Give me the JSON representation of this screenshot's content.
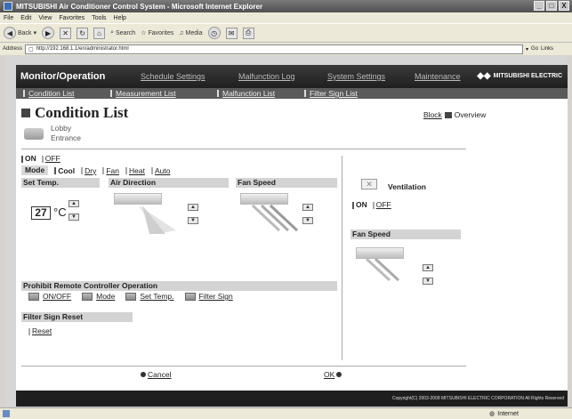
{
  "window": {
    "title": "MITSUBISHI Air Conditioner Control System - Microsoft Internet Explorer",
    "controls": [
      "_",
      "□",
      "X"
    ]
  },
  "menubar": [
    "File",
    "Edit",
    "View",
    "Favorites",
    "Tools",
    "Help"
  ],
  "toolbar": {
    "back": "Back",
    "search": "Search",
    "favorites": "Favorites",
    "media": "Media"
  },
  "address": {
    "label": "Address",
    "url": "http://192.168.1.1/en/administrator.html",
    "go": "Go",
    "links": "Links"
  },
  "nav": {
    "title": "Monitor/Operation",
    "items": [
      "Schedule Settings",
      "Malfunction Log",
      "System Settings",
      "Maintenance"
    ],
    "brand": "MITSUBISHI ELECTRIC"
  },
  "subnav": {
    "items": [
      "Condition List",
      "Measurement List",
      "Malfunction List",
      "Filter Sign List"
    ]
  },
  "heading": {
    "title": "Condition List",
    "block_link": "Block",
    "overview": "Overview"
  },
  "unit": {
    "line1": "Lobby",
    "line2": "Entrance"
  },
  "control": {
    "on": "ON",
    "off": "OFF",
    "mode_label": "Mode",
    "modes": [
      "Cool",
      "Dry",
      "Fan",
      "Heat",
      "Auto"
    ],
    "set_temp_label": "Set Temp.",
    "air_direction_label": "Air Direction",
    "fan_speed_label": "Fan Speed",
    "temp_value": "27",
    "temp_unit": "°C"
  },
  "prohibit": {
    "label": "Prohibit Remote Controller Operation",
    "items": [
      "ON/OFF",
      "Mode",
      "Set Temp.",
      "Filter Sign"
    ]
  },
  "filter": {
    "label": "Filter Sign Reset",
    "reset": "Reset"
  },
  "ventilation": {
    "label": "Ventilation",
    "on": "ON",
    "off": "OFF",
    "fan_speed_label": "Fan Speed"
  },
  "actions": {
    "cancel": "Cancel",
    "ok": "OK"
  },
  "footer": {
    "copyright": "Copyright(C) 2003-2008 MITSUBISHI ELECTRIC CORPORATION All Rights Reserved"
  },
  "status": {
    "zone": "Internet"
  },
  "colors": {
    "nav_bg": "#2b2b2b",
    "subnav_bg": "#5a5a5a",
    "section_bg": "#d3d3d3"
  }
}
